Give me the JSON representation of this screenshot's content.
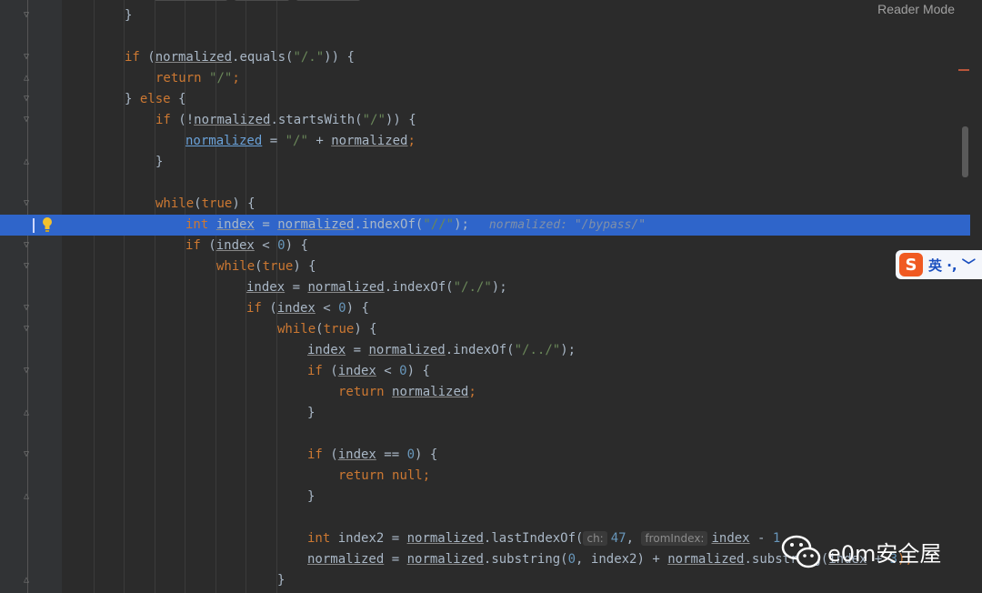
{
  "reader_mode_label": "Reader Mode",
  "inlay_hint": "normalized: \"/bypass/\"",
  "param_hints": {
    "ch": "ch:",
    "from_index": "fromIndex:"
  },
  "ime": {
    "logo": "S",
    "label": "英 ·, ﹀"
  },
  "watermark": {
    "text": "e0m安全屋"
  },
  "colors": {
    "editor_bg": "#2b2b2b",
    "gutter_bg": "#313335",
    "highlight": "#2f65ca",
    "keyword": "#cc7832",
    "string": "#6a8759",
    "number": "#6897bb",
    "text": "#a9b7c6"
  },
  "icons": [
    "lightbulb-icon",
    "fold-marker-icon",
    "sogou-ime-icon",
    "wechat-icon"
  ],
  "code": {
    "l0": "}",
    "l1": [
      "if",
      " (",
      "normalized",
      ".equals(",
      "\"/.\"",
      ")) {"
    ],
    "l2": [
      "return",
      " ",
      "\"/\"",
      ";"
    ],
    "l3": [
      "} ",
      "else",
      " {"
    ],
    "l4": [
      "if",
      " (!",
      "normalized",
      ".startsWith(",
      "\"/\"",
      ")) {"
    ],
    "l5": [
      "normalized",
      " = ",
      "\"/\"",
      " + ",
      "normalized",
      ";"
    ],
    "l6": "}",
    "l7": [
      "while",
      "(",
      "true",
      ") {"
    ],
    "l8": [
      "int",
      " ",
      "index",
      " = ",
      "normalized",
      ".indexOf(",
      "\"//\"",
      ");"
    ],
    "l9": [
      "if",
      " (",
      "index",
      " < ",
      "0",
      ") {"
    ],
    "l10": [
      "while",
      "(",
      "true",
      ") {"
    ],
    "l11": [
      "index",
      " = ",
      "normalized",
      ".indexOf(",
      "\"/./\"",
      ");"
    ],
    "l12": [
      "if",
      " (",
      "index",
      " < ",
      "0",
      ") {"
    ],
    "l13": [
      "while",
      "(",
      "true",
      ") {"
    ],
    "l14": [
      "index",
      " = ",
      "normalized",
      ".indexOf(",
      "\"/../\"",
      ");"
    ],
    "l15": [
      "if",
      " (",
      "index",
      " < ",
      "0",
      ") {"
    ],
    "l16": [
      "return",
      " ",
      "normalized",
      ";"
    ],
    "l17": "}",
    "l18": [
      "if",
      " (",
      "index",
      " == ",
      "0",
      ") {"
    ],
    "l19": [
      "return",
      " ",
      "null",
      ";"
    ],
    "l20": "}",
    "l21": [
      "int",
      " index2 = ",
      "normalized",
      ".lastIndexOf(",
      "47",
      ",",
      "index",
      " - ",
      "1"
    ],
    "l22": [
      "normalized",
      " = ",
      "normalized",
      ".substring(",
      "0",
      ", index2) + ",
      "normalized",
      ".substring(",
      "index",
      " + ",
      "3",
      ");"
    ],
    "l23": "}"
  }
}
